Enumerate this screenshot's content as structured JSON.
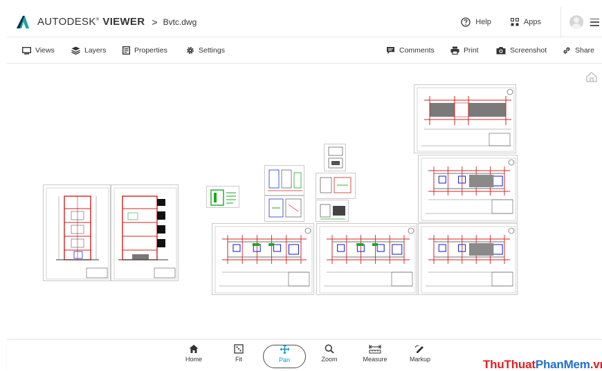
{
  "header": {
    "brand_left": "AUTODESK",
    "brand_tm": "®",
    "brand_right": "VIEWER",
    "separator": ">",
    "filename": "Bvtc.dwg",
    "help_label": "Help",
    "apps_label": "Apps",
    "logo_icon": "autodesk-logo",
    "help_icon": "question-circle-icon",
    "apps_icon": "grid-icon",
    "menu_icon": "hamburger-icon"
  },
  "toolbar": {
    "left": [
      {
        "label": "Views",
        "icon": "monitor-icon"
      },
      {
        "label": "Layers",
        "icon": "layers-icon"
      },
      {
        "label": "Properties",
        "icon": "document-icon"
      },
      {
        "label": "Settings",
        "icon": "gear-icon"
      }
    ],
    "right": [
      {
        "label": "Comments",
        "icon": "comment-icon"
      },
      {
        "label": "Print",
        "icon": "printer-icon"
      },
      {
        "label": "Screenshot",
        "icon": "camera-icon"
      },
      {
        "label": "Share",
        "icon": "link-icon"
      }
    ]
  },
  "bottombar": {
    "items": [
      {
        "label": "Home",
        "icon": "home-icon"
      },
      {
        "label": "Fit",
        "icon": "fit-icon"
      },
      {
        "label": "Pan",
        "icon": "pan-icon",
        "active": true
      },
      {
        "label": "Zoom",
        "icon": "zoom-icon"
      },
      {
        "label": "Measure",
        "icon": "ruler-icon"
      },
      {
        "label": "Markup",
        "icon": "pencil-icon"
      }
    ]
  },
  "watermark": {
    "part1": "ThuThuat",
    "part2": "PhanMem",
    "part3": ".vn"
  },
  "colors": {
    "accent": "#0696d7",
    "drawing_red": "#d42020",
    "drawing_blue": "#1a2fd6",
    "drawing_green": "#1aa821",
    "watermark_red": "#e02020",
    "watermark_blue": "#1f6fd0"
  }
}
